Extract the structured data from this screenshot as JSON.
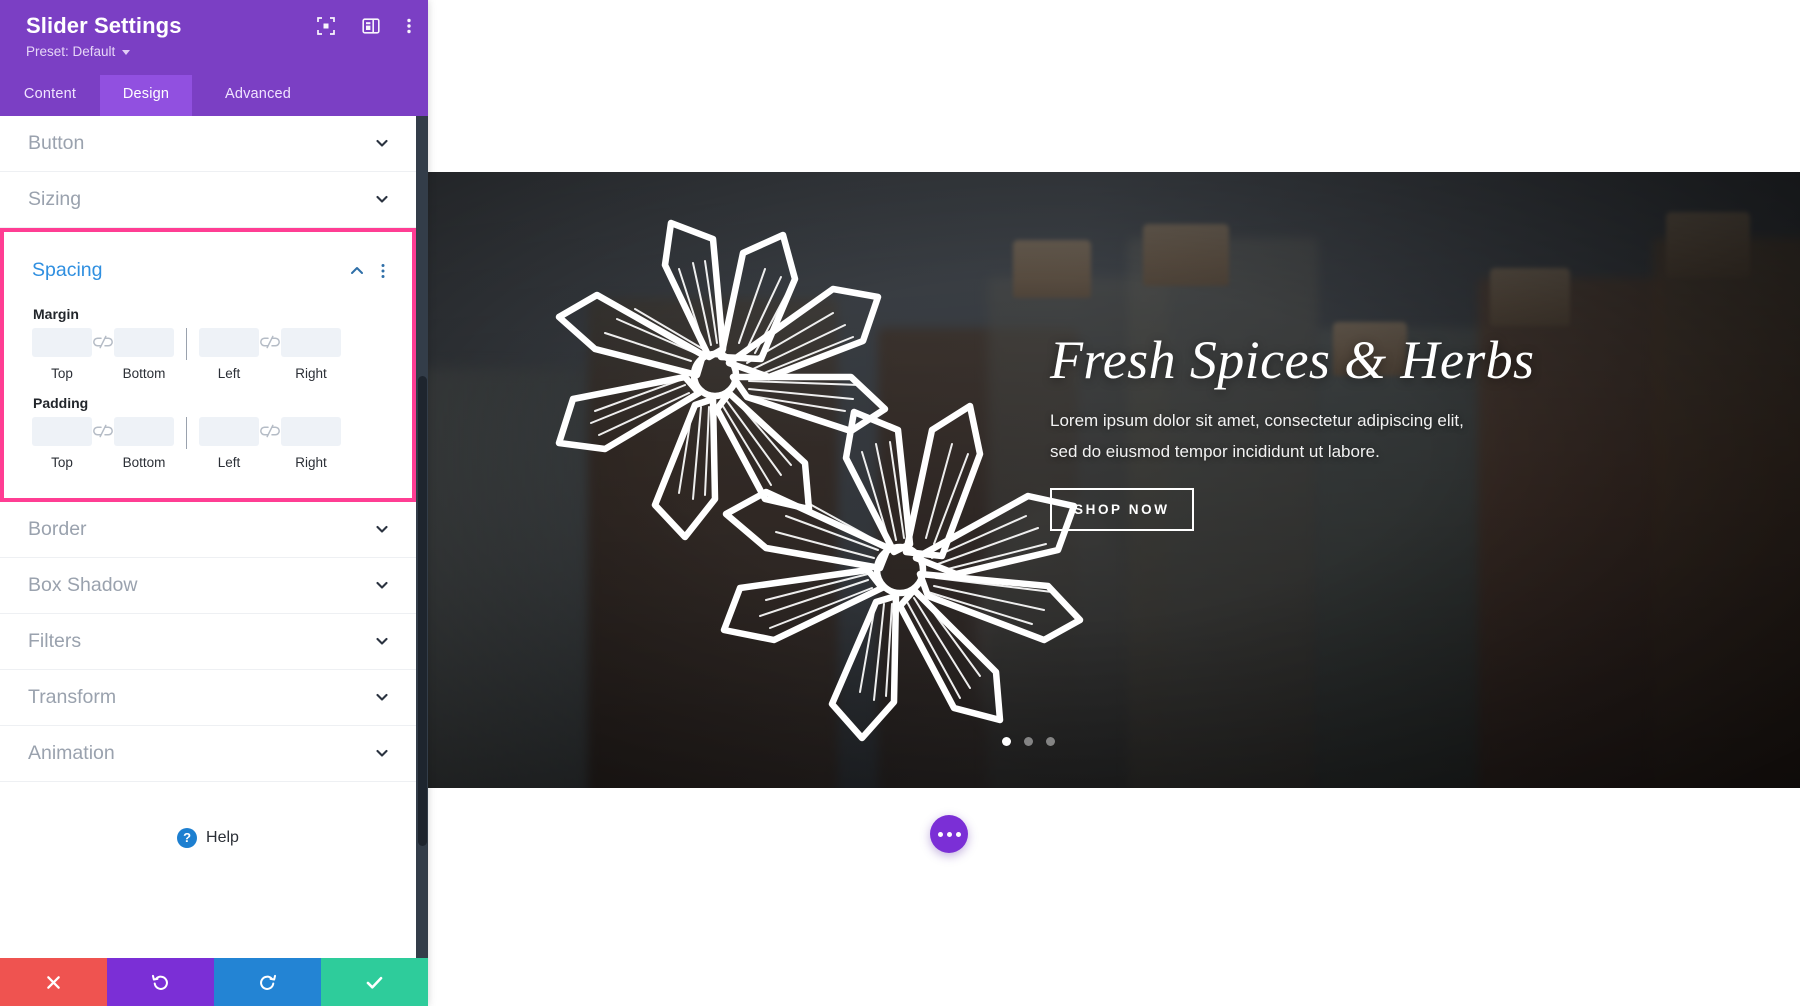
{
  "panel": {
    "title": "Slider Settings",
    "preset_label": "Preset: Default",
    "header_icons": [
      {
        "name": "focus-icon",
        "label": "Focus"
      },
      {
        "name": "layout-panel-icon",
        "label": "Panel Layout"
      },
      {
        "name": "more-vertical-icon",
        "label": "More Options"
      }
    ],
    "tabs": [
      {
        "id": "content",
        "label": "Content",
        "active": false
      },
      {
        "id": "design",
        "label": "Design",
        "active": true
      },
      {
        "id": "advanced",
        "label": "Advanced",
        "active": false
      }
    ],
    "sections_above": [
      {
        "id": "button",
        "label": "Button",
        "state": "collapsed"
      },
      {
        "id": "sizing",
        "label": "Sizing",
        "state": "collapsed"
      }
    ],
    "spacing": {
      "title": "Spacing",
      "state": "expanded",
      "highlighted": true,
      "highlight_color": "#ff3d93",
      "title_color": "#2f8fe0",
      "groups": [
        {
          "label": "Margin",
          "fields": [
            {
              "caption": "Top",
              "value": "",
              "placeholder": ""
            },
            {
              "caption": "Bottom",
              "value": "",
              "placeholder": ""
            },
            {
              "caption": "Left",
              "value": "",
              "placeholder": ""
            },
            {
              "caption": "Right",
              "value": "",
              "placeholder": ""
            }
          ]
        },
        {
          "label": "Padding",
          "fields": [
            {
              "caption": "Top",
              "value": "",
              "placeholder": ""
            },
            {
              "caption": "Bottom",
              "value": "",
              "placeholder": ""
            },
            {
              "caption": "Left",
              "value": "",
              "placeholder": ""
            },
            {
              "caption": "Right",
              "value": "",
              "placeholder": ""
            }
          ]
        }
      ]
    },
    "sections_below": [
      {
        "id": "border",
        "label": "Border",
        "state": "collapsed"
      },
      {
        "id": "box-shadow",
        "label": "Box Shadow",
        "state": "collapsed"
      },
      {
        "id": "filters",
        "label": "Filters",
        "state": "collapsed"
      },
      {
        "id": "transform",
        "label": "Transform",
        "state": "collapsed"
      },
      {
        "id": "animation",
        "label": "Animation",
        "state": "collapsed"
      }
    ],
    "help": {
      "label": "Help",
      "badge": "?"
    },
    "footer": [
      {
        "id": "cancel",
        "icon": "close-icon",
        "color": "#ef5350"
      },
      {
        "id": "undo",
        "icon": "undo-icon",
        "color": "#7b2fd6"
      },
      {
        "id": "redo",
        "icon": "redo-icon",
        "color": "#2384d4"
      },
      {
        "id": "save",
        "icon": "check-icon",
        "color": "#2ecc9b"
      }
    ]
  },
  "canvas": {
    "slide": {
      "heading": "Fresh Spices & Herbs",
      "body_line1": "Lorem ipsum dolor sit amet, consectetur adipiscing elit,",
      "body_line2": "sed do eiusmod tempor incididunt ut labore.",
      "button_label": "SHOP NOW"
    },
    "pagination": {
      "total": 3,
      "active_index": 0
    },
    "fab": {
      "name": "more-options-fab",
      "glyph": "•••"
    }
  }
}
